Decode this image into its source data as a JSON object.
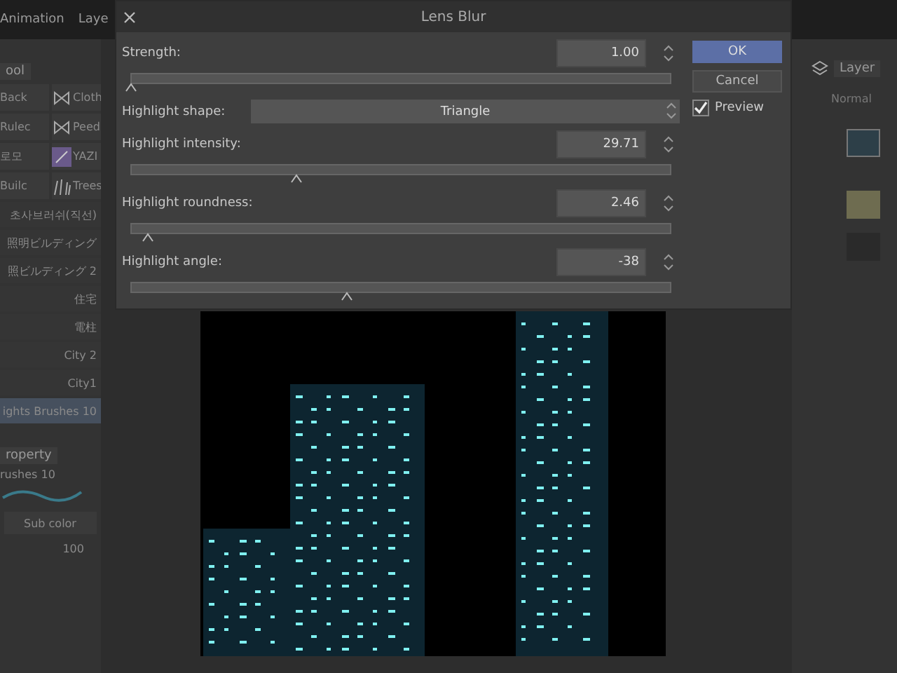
{
  "menu_bar": {
    "items": [
      "Animation",
      "Laye"
    ]
  },
  "tool_panel": {
    "tab": "ool",
    "brush_grid": [
      {
        "label": "Back"
      },
      {
        "label": "Cloth"
      },
      {
        "label": "Rulec"
      },
      {
        "label": "Peed"
      },
      {
        "label": "로모"
      },
      {
        "label": "YAZI"
      },
      {
        "label": "Builc"
      },
      {
        "label": "Trees"
      }
    ],
    "brush_list": [
      {
        "label": "초사브러쉬(직선)",
        "selected": false
      },
      {
        "label": "照明ビルディング",
        "selected": false
      },
      {
        "label": "照ビルディング 2",
        "selected": false
      },
      {
        "label": "住宅",
        "selected": false
      },
      {
        "label": "電柱",
        "selected": false
      },
      {
        "label": "City 2",
        "selected": false
      },
      {
        "label": "City1",
        "selected": false
      },
      {
        "label": "ights Brushes 10",
        "selected": true
      }
    ]
  },
  "property_panel": {
    "tab": "roperty",
    "brush_name": "rushes 10",
    "color_mode": "Sub color",
    "value": "100"
  },
  "layer_panel": {
    "tab": "Layer",
    "blend_mode": "Normal"
  },
  "dialog": {
    "title": "Lens Blur",
    "rows": [
      {
        "kind": "slider",
        "label": "Strength:",
        "value": "1.00",
        "level": 0.0
      },
      {
        "kind": "select",
        "label": "Highlight shape:",
        "value": "Triangle"
      },
      {
        "kind": "slider",
        "label": "Highlight intensity:",
        "value": "29.71",
        "level": 0.3
      },
      {
        "kind": "slider",
        "label": "Highlight roundness:",
        "value": "2.46",
        "level": 0.03
      },
      {
        "kind": "slider",
        "label": "Highlight angle:",
        "value": "-38",
        "level": 0.39
      }
    ],
    "buttons": [
      {
        "label": "OK",
        "primary": true
      },
      {
        "label": "Cancel",
        "primary": false
      }
    ],
    "preview": {
      "label": "Preview",
      "checked": true
    }
  }
}
